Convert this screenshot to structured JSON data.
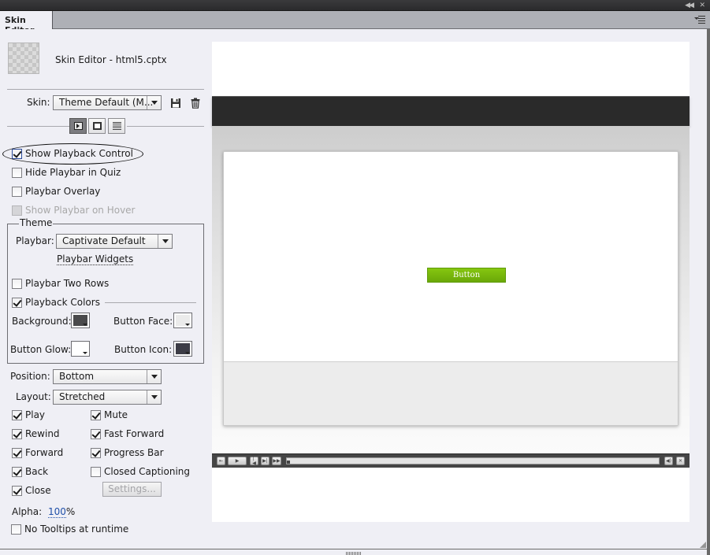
{
  "window": {
    "title_controls": {
      "collapse": "collapse-icon",
      "close": "close-icon"
    }
  },
  "tabbar": {
    "tabs": [
      {
        "label": "Skin Editor",
        "active": true
      }
    ],
    "panel_menu": "panel-menu-icon"
  },
  "header": {
    "title": "Skin Editor - html5.cptx",
    "thumbnail": "transparent-thumbnail"
  },
  "skin": {
    "label": "Skin:",
    "value": "Theme Default (M...",
    "save_icon": "save-icon",
    "delete_icon": "trash-icon"
  },
  "view_tabs": [
    {
      "name": "playback-control",
      "icon": "playbar-icon",
      "active": true
    },
    {
      "name": "borders",
      "icon": "border-icon",
      "active": false
    },
    {
      "name": "table-of-contents",
      "icon": "toc-icon",
      "active": false
    }
  ],
  "options": {
    "show_playback_control": {
      "label": "Show Playback Control",
      "checked": true
    },
    "hide_playbar_in_quiz": {
      "label": "Hide Playbar in Quiz",
      "checked": false
    },
    "playbar_overlay": {
      "label": "Playbar Overlay",
      "checked": false
    },
    "show_playbar_on_hover": {
      "label": "Show Playbar on Hover",
      "checked": false,
      "disabled": true
    }
  },
  "theme": {
    "legend": "Theme",
    "playbar_label": "Playbar:",
    "playbar_value": "Captivate Default",
    "widgets_link": "Playbar Widgets",
    "two_rows": {
      "label": "Playbar Two Rows",
      "checked": false
    },
    "playback_colors": {
      "label": "Playback Colors",
      "checked": true
    },
    "colors": {
      "background": {
        "label": "Background:",
        "color": "#4a4a4c"
      },
      "button_face": {
        "label": "Button Face:",
        "color": "#ebebeb"
      },
      "button_glow": {
        "label": "Button Glow:",
        "color": "#ffffff"
      },
      "button_icon": {
        "label": "Button Icon:",
        "color": "#3c3c46"
      }
    }
  },
  "position": {
    "label": "Position:",
    "value": "Bottom"
  },
  "layout": {
    "label": "Layout:",
    "value": "Stretched"
  },
  "controls": [
    {
      "label": "Play",
      "checked": true
    },
    {
      "label": "Mute",
      "checked": true
    },
    {
      "label": "Rewind",
      "checked": true
    },
    {
      "label": "Fast Forward",
      "checked": true
    },
    {
      "label": "Forward",
      "checked": true
    },
    {
      "label": "Progress Bar",
      "checked": true
    },
    {
      "label": "Back",
      "checked": true
    },
    {
      "label": "Closed Captioning",
      "checked": false
    },
    {
      "label": "Close",
      "checked": true
    }
  ],
  "settings_button": {
    "label": "Settings...",
    "disabled": true
  },
  "alpha": {
    "label": "Alpha:",
    "value": "100",
    "unit": "%"
  },
  "no_tooltips": {
    "label": "No Tooltips at runtime",
    "checked": false
  },
  "preview": {
    "button_label": "Button",
    "button_color": "#78b70c",
    "playbar": {
      "buttons": [
        "exit-icon",
        "play-icon",
        "rewind-icon",
        "back-icon",
        "forward-icon"
      ],
      "right_buttons": [
        "mute-icon",
        "close-icon"
      ],
      "progress": 0
    }
  }
}
